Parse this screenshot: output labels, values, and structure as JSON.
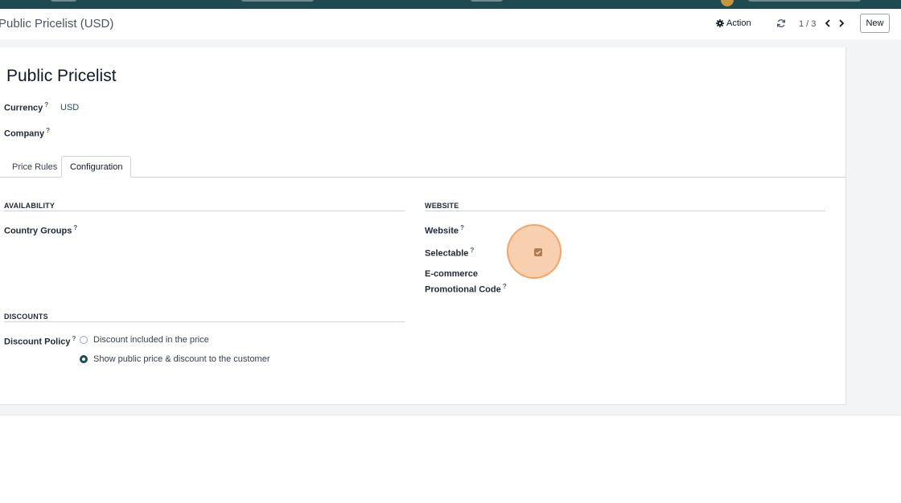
{
  "breadcrumb": "Public Pricelist (USD)",
  "control": {
    "action_label": "Action",
    "pager": "1 / 3",
    "new_label": "New"
  },
  "record": {
    "title": "Public Pricelist",
    "currency_label": "Currency",
    "currency_value": "USD",
    "company_label": "Company",
    "help_mark": "?"
  },
  "tabs": [
    {
      "label": "Price Rules",
      "active": false
    },
    {
      "label": "Configuration",
      "active": true
    }
  ],
  "availability": {
    "title": "AVAILABILITY",
    "country_groups_label": "Country Groups"
  },
  "website_section": {
    "title": "WEBSITE",
    "website_label": "Website",
    "selectable_label": "Selectable",
    "selectable_checked": true,
    "promo_label": "E-commerce Promotional Code"
  },
  "discounts": {
    "title": "DISCOUNTS",
    "policy_label": "Discount Policy",
    "options": [
      {
        "label": "Discount included in the price",
        "selected": false
      },
      {
        "label": "Show public price & discount to the customer",
        "selected": true
      }
    ]
  },
  "colors": {
    "navbar": "#1e4a52",
    "accent": "#1e4a52",
    "checkbox": "#5b4538",
    "click_highlight": "#f4aa6e"
  }
}
